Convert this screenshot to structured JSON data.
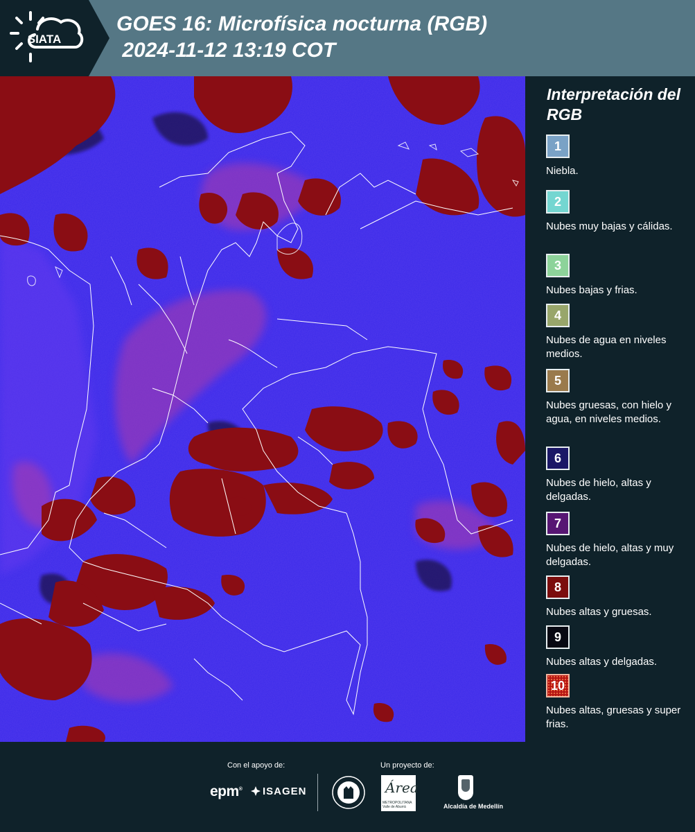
{
  "header": {
    "logo_text": "SIATA",
    "title_line1": "GOES 16: Microfísica nocturna (RGB)",
    "title_line2": " 2024-11-12 13:19 COT"
  },
  "legend": {
    "title": "Interpretación del RGB",
    "items": [
      {
        "number": "1",
        "label": "Niebla.",
        "color": "#7aa2c6"
      },
      {
        "number": "2",
        "label": "Nubes muy bajas y cálidas.",
        "color": "#74d6d1"
      },
      {
        "number": "3",
        "label": "Nubes bajas y frias.",
        "color": "#8dd39a"
      },
      {
        "number": "4",
        "label": "Nubes de agua en niveles medios.",
        "color": "#98a66b"
      },
      {
        "number": "5",
        "label": "Nubes gruesas, con hielo y agua, en niveles medios.",
        "color": "#9a7a4c"
      },
      {
        "number": "6",
        "label": "Nubes de hielo, altas y delgadas.",
        "color": "#1b1766"
      },
      {
        "number": "7",
        "label": "Nubes de hielo, altas y muy delgadas.",
        "color": "#571673"
      },
      {
        "number": "8",
        "label": "Nubes altas y gruesas.",
        "color": "#7b0d0d"
      },
      {
        "number": "9",
        "label": "Nubes altas y delgadas.",
        "color": "#080812"
      },
      {
        "number": "10",
        "label": "Nubes altas, gruesas y super frias.",
        "color": "#b51212"
      }
    ]
  },
  "footer": {
    "support_label": "Con el apoyo de:",
    "project_label": "Un proyecto de:",
    "sponsor_1": "epm",
    "sponsor_2": "ISAGEN",
    "partner_1_script": "Área",
    "partner_1_sub": "METROPOLITANA Valle de Aburrá",
    "partner_2": "Alcaldía de Medellín"
  },
  "colors": {
    "header_bg": "#557785",
    "panel_bg": "#0f222a",
    "map_base": "#3a2aea",
    "cloud_high_thick": "#8a0d14"
  }
}
